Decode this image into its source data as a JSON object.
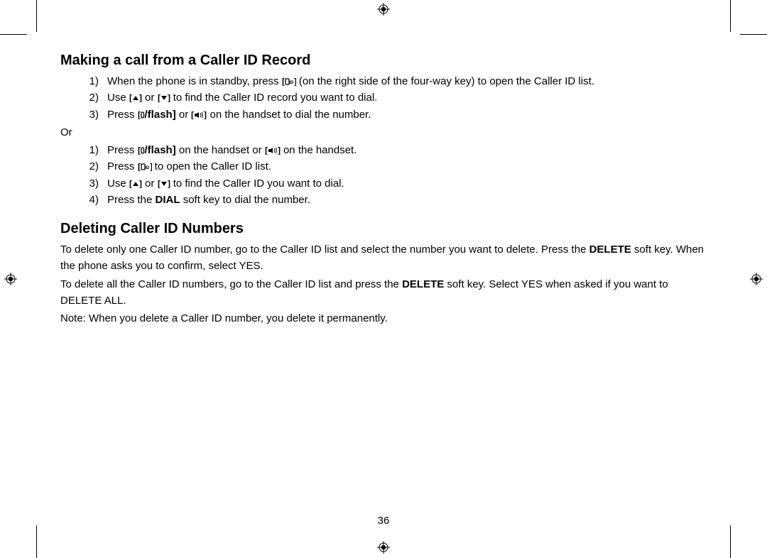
{
  "page_number": "36",
  "section1": {
    "heading": "Making a call from a Caller ID Record",
    "list_a": {
      "item1_a": "When the phone is in standby, press ",
      "item1_b": " (on the right side of the four-way key) to open the Caller ID list.",
      "item2_a": "Use ",
      "item2_b": " or ",
      "item2_c": " to find the Caller ID record you want to dial.",
      "item3_a": "Press ",
      "item3_flash": "/flash]",
      "item3_b": " or ",
      "item3_c": " on the handset to dial the number."
    },
    "or": "Or",
    "list_b": {
      "item1_a": "Press ",
      "item1_flash": "/flash]",
      "item1_b": " on the handset or ",
      "item1_c": " on the handset.",
      "item2_a": "Press ",
      "item2_b": " to open the Caller ID list.",
      "item3_a": "Use ",
      "item3_b": " or ",
      "item3_c": " to find the Caller ID you want to dial.",
      "item4_a": "Press the ",
      "item4_dial": "DIAL",
      "item4_b": " soft key to dial the number."
    }
  },
  "section2": {
    "heading": "Deleting Caller ID Numbers",
    "p1_a": "To delete only one Caller ID number, go to the Caller ID list and select the number you want to delete. Press the ",
    "p1_delete": "DELETE",
    "p1_b": " soft key. When the phone asks you to confirm, select YES.",
    "p2_a": "To delete all the Caller ID numbers, go to the Caller ID list and press the ",
    "p2_delete": "DELETE",
    "p2_b": " soft key. Select YES when asked if you want to DELETE ALL.",
    "p3": "Note: When you delete a Caller ID number, you delete it permanently."
  }
}
